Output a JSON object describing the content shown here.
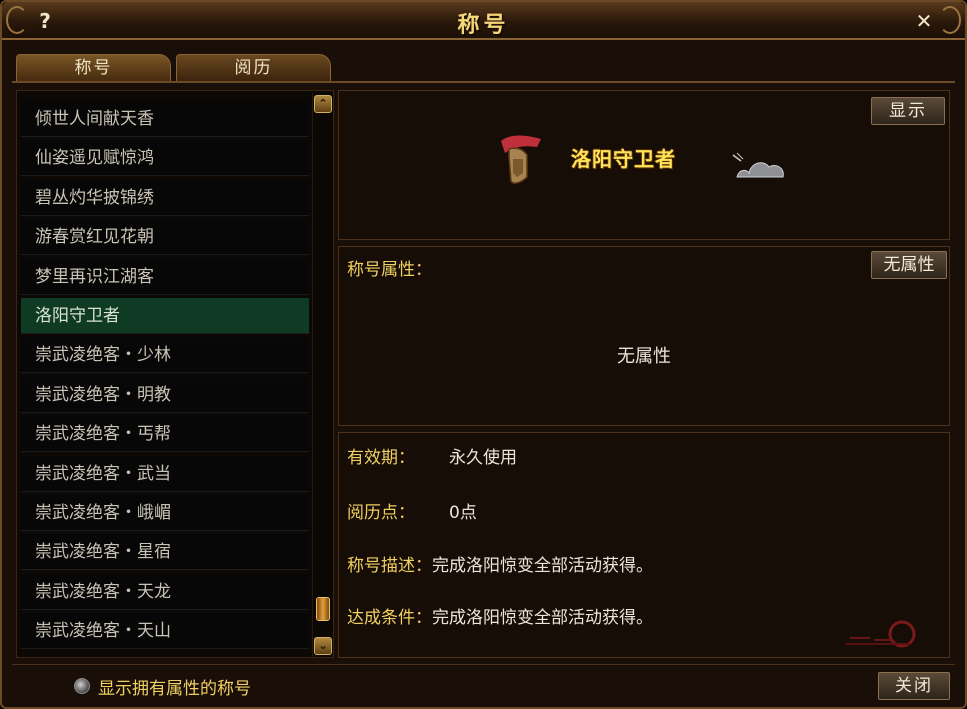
{
  "window": {
    "title": "称号",
    "help_glyph": "?",
    "close_glyph": "✕"
  },
  "tabs": [
    {
      "label": "称号",
      "active": true
    },
    {
      "label": "阅历",
      "active": false
    }
  ],
  "title_list": {
    "items": [
      "倾世人间献天香",
      "仙姿遥见赋惊鸿",
      "碧丛灼华披锦绣",
      "游春赏红见花朝",
      "梦里再识江湖客",
      "洛阳守卫者",
      "崇武凌绝客・少林",
      "崇武凌绝客・明教",
      "崇武凌绝客・丐帮",
      "崇武凌绝客・武当",
      "崇武凌绝客・峨嵋",
      "崇武凌绝客・星宿",
      "崇武凌绝客・天龙",
      "崇武凌绝客・天山"
    ],
    "selected_index": 5,
    "scroll_up_glyph": "⌃",
    "scroll_down_glyph": "⌄"
  },
  "preview": {
    "show_button": "显示",
    "badge_text": "洛阳守卫者"
  },
  "attributes": {
    "label": "称号属性：",
    "button": "无属性",
    "value": "无属性"
  },
  "info": {
    "validity_label": "有效期：",
    "validity_value": "永久使用",
    "points_label": "阅历点：",
    "points_value": "0点",
    "desc_label": "称号描述：",
    "desc_value": "完成洛阳惊变全部活动获得。",
    "cond_label": "达成条件：",
    "cond_value": "完成洛阳惊变全部活动获得。"
  },
  "footer": {
    "filter_label": "显示拥有属性的称号",
    "close_button": "关闭"
  },
  "colors": {
    "accent_gold": "#f0d060",
    "selected_row": "#0f3a24",
    "frame_brown": "#6b4a25"
  }
}
